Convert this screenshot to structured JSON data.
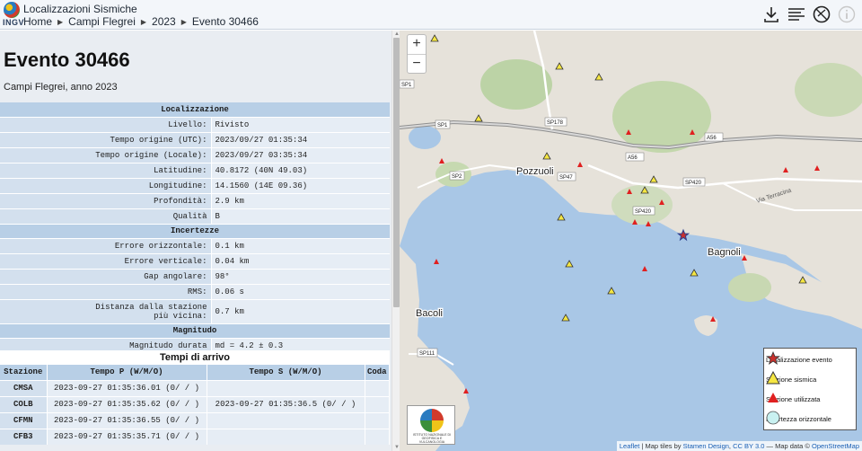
{
  "header": {
    "app_title": "Localizzazioni Sismiche",
    "logo_text": "INGV",
    "breadcrumb": [
      "Home",
      "Campi Flegrei",
      "2023",
      "Evento 30466"
    ]
  },
  "event": {
    "title": "Evento 30466",
    "subtitle": "Campi Flegrei, anno 2023"
  },
  "localizzazione": {
    "section": "Localizzazione",
    "rows": [
      {
        "label": "Livello:",
        "value": "Rivisto"
      },
      {
        "label": "Tempo origine (UTC):",
        "value": "2023/09/27 01:35:34"
      },
      {
        "label": "Tempo origine (Locale):",
        "value": "2023/09/27 03:35:34"
      },
      {
        "label": "Latitudine:",
        "value": "40.8172 (40N 49.03)"
      },
      {
        "label": "Longitudine:",
        "value": "14.1560 (14E 09.36)"
      },
      {
        "label": "Profondità:",
        "value": "2.9 km"
      },
      {
        "label": "Qualità",
        "value": "B"
      }
    ]
  },
  "incertezze": {
    "section": "Incertezze",
    "rows": [
      {
        "label": "Errore orizzontale:",
        "value": "0.1 km"
      },
      {
        "label": "Errore verticale:",
        "value": "0.04 km"
      },
      {
        "label": "Gap angolare:",
        "value": "98°"
      },
      {
        "label": "RMS:",
        "value": "0.06 s"
      },
      {
        "label_line1": "Distanza dalla stazione",
        "label_line2": "più vicina:",
        "value": "0.7 km"
      }
    ]
  },
  "magnitudo": {
    "section": "Magnitudo",
    "rows": [
      {
        "label": "Magnitudo durata",
        "value": "md = 4.2 ± 0.3"
      }
    ]
  },
  "arrivals": {
    "title": "Tempi di arrivo",
    "columns": [
      "Stazione",
      "Tempo P (W/M/O)",
      "Tempo S (W/M/O)",
      "Coda"
    ],
    "rows": [
      {
        "station": "CMSA",
        "p": "2023-09-27 01:35:36.01 (0/ / )",
        "s": "",
        "coda": ""
      },
      {
        "station": "COLB",
        "p": "2023-09-27 01:35:35.62 (0/ / )",
        "s": "2023-09-27 01:35:36.5 (0/ / )",
        "coda": ""
      },
      {
        "station": "CFMN",
        "p": "2023-09-27 01:35:36.55 (0/ / )",
        "s": "",
        "coda": ""
      },
      {
        "station": "CFB3",
        "p": "2023-09-27 01:35:35.71 (0/ / )",
        "s": "",
        "coda": ""
      }
    ]
  },
  "map": {
    "zoom_in": "+",
    "zoom_out": "−",
    "place_labels": [
      "Pozzuoli",
      "Bagnoli",
      "Bacoli"
    ],
    "road_labels": [
      "SP1",
      "SP1",
      "SP178",
      "A56",
      "A56",
      "SP2",
      "SP47",
      "SP420",
      "SP420",
      "SP111",
      "Via Terracina"
    ],
    "legend": {
      "event": "Localizzazione evento",
      "seismic_station": "Stazione sismica",
      "used_station": "Stazione utilizzata",
      "uncertainty": "Incertezza orizzontale"
    },
    "badge_caption": "ISTITUTO NAZIONALE DI GEOFISICA E VULCANOLOGIA",
    "attribution": {
      "leaflet": "Leaflet",
      "tiles_prefix": "| Map tiles by",
      "stamen": "Stamen Design",
      "cc": "CC BY 3.0",
      "data_prefix": "— Map data ©",
      "osm": "OpenStreetMap"
    },
    "colors": {
      "sea": "#a9c7e6",
      "land": "#e8e4dc",
      "station_seismic": "#f5e642",
      "station_used": "#e02020",
      "event_star": "#c9302c"
    }
  },
  "icons": [
    "download-icon",
    "list-icon",
    "globe-disabled-icon",
    "info-icon"
  ]
}
